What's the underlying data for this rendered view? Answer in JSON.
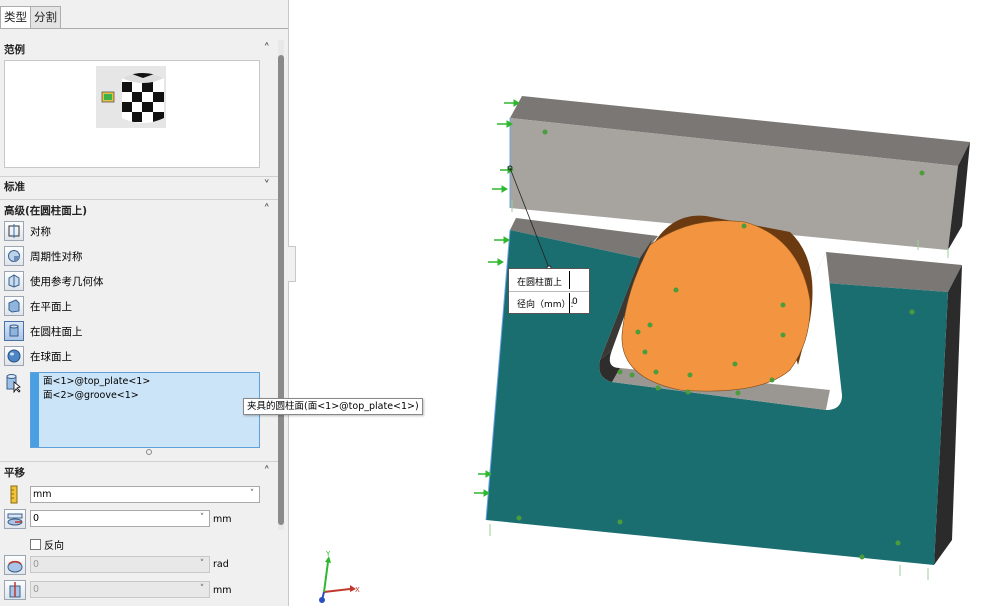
{
  "tabs": [
    {
      "label": "类型"
    },
    {
      "label": "分割"
    }
  ],
  "sections": {
    "example": {
      "title": "范例"
    },
    "standard": {
      "title": "标准"
    },
    "advanced": {
      "title": "高级(在圆柱面上)",
      "options": [
        {
          "label": "对称",
          "icon": "symmetric-icon"
        },
        {
          "label": "周期性对称",
          "icon": "cyclic-symmetry-icon"
        },
        {
          "label": "使用参考几何体",
          "icon": "reference-geometry-icon"
        },
        {
          "label": "在平面上",
          "icon": "on-flat-faces-icon"
        },
        {
          "label": "在圆柱面上",
          "icon": "on-cylindrical-faces-icon",
          "selected": true
        },
        {
          "label": "在球面上",
          "icon": "on-spherical-faces-icon"
        }
      ],
      "faces": [
        "面<1>@top_plate<1>",
        "面<2>@groove<1>"
      ],
      "tooltip": "夹具的圆柱面(面<1>@top_plate<1>)"
    },
    "translation": {
      "title": "平移",
      "units_value": "mm",
      "radial_value": "0",
      "radial_unit": "mm",
      "reverse_label": "反向",
      "circumferential_value": "0",
      "circumferential_unit": "rad",
      "axial_value": "0",
      "axial_unit": "mm"
    }
  },
  "callout": {
    "title": "在圆柱面上",
    "label": "径向（mm）:",
    "value": "0"
  },
  "triad": {
    "x": "X",
    "y": "Y"
  },
  "colors": {
    "plate_top": "#a8a5a0",
    "plate_front": "#1b6e70",
    "cylinder": "#f29440",
    "arrow": "#2fb82f"
  }
}
